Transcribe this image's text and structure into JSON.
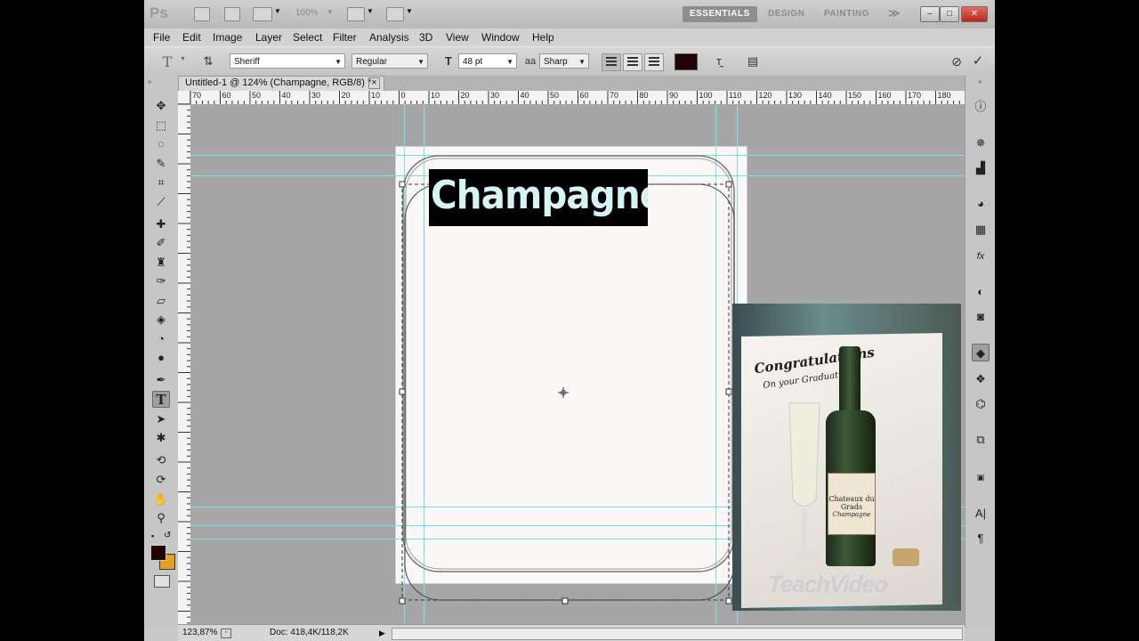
{
  "app": {
    "logo": "Ps"
  },
  "titlebar": {
    "zoom_display": "100%",
    "workspaces": [
      "ESSENTIALS",
      "DESIGN",
      "PAINTING"
    ],
    "more": "≫"
  },
  "menu": [
    "File",
    "Edit",
    "Image",
    "Layer",
    "Select",
    "Filter",
    "Analysis",
    "3D",
    "View",
    "Window",
    "Help"
  ],
  "options": {
    "font_family": "Sheriff",
    "font_style": "Regular",
    "font_size": "48 pt",
    "antialias": "Sharp",
    "text_color": "#220404"
  },
  "document": {
    "tab_title": "Untitled-1 @ 124% (Champagne, RGB/8) *",
    "close": "×",
    "text_content": "Champagne"
  },
  "ruler": {
    "h_labels": [
      "70",
      "60",
      "50",
      "40",
      "30",
      "20",
      "10",
      "0",
      "10",
      "20",
      "30",
      "40",
      "50",
      "60",
      "70",
      "80",
      "90",
      "100",
      "110",
      "120",
      "130",
      "140",
      "150",
      "160",
      "170",
      "180"
    ]
  },
  "status": {
    "zoom": "123,87%",
    "doc_info": "Doc: 418,4K/118,2K"
  },
  "photo": {
    "card_line1": "Congratulations",
    "card_line2": "On your Graduation",
    "label_line1": "Chateaux du Grads",
    "label_line2": "Champagne",
    "watermark": "TeachVideo"
  },
  "colors": {
    "accent_guide": "#6fe6e6",
    "foreground": "#220404",
    "background_swatch": "#e8a11a"
  }
}
